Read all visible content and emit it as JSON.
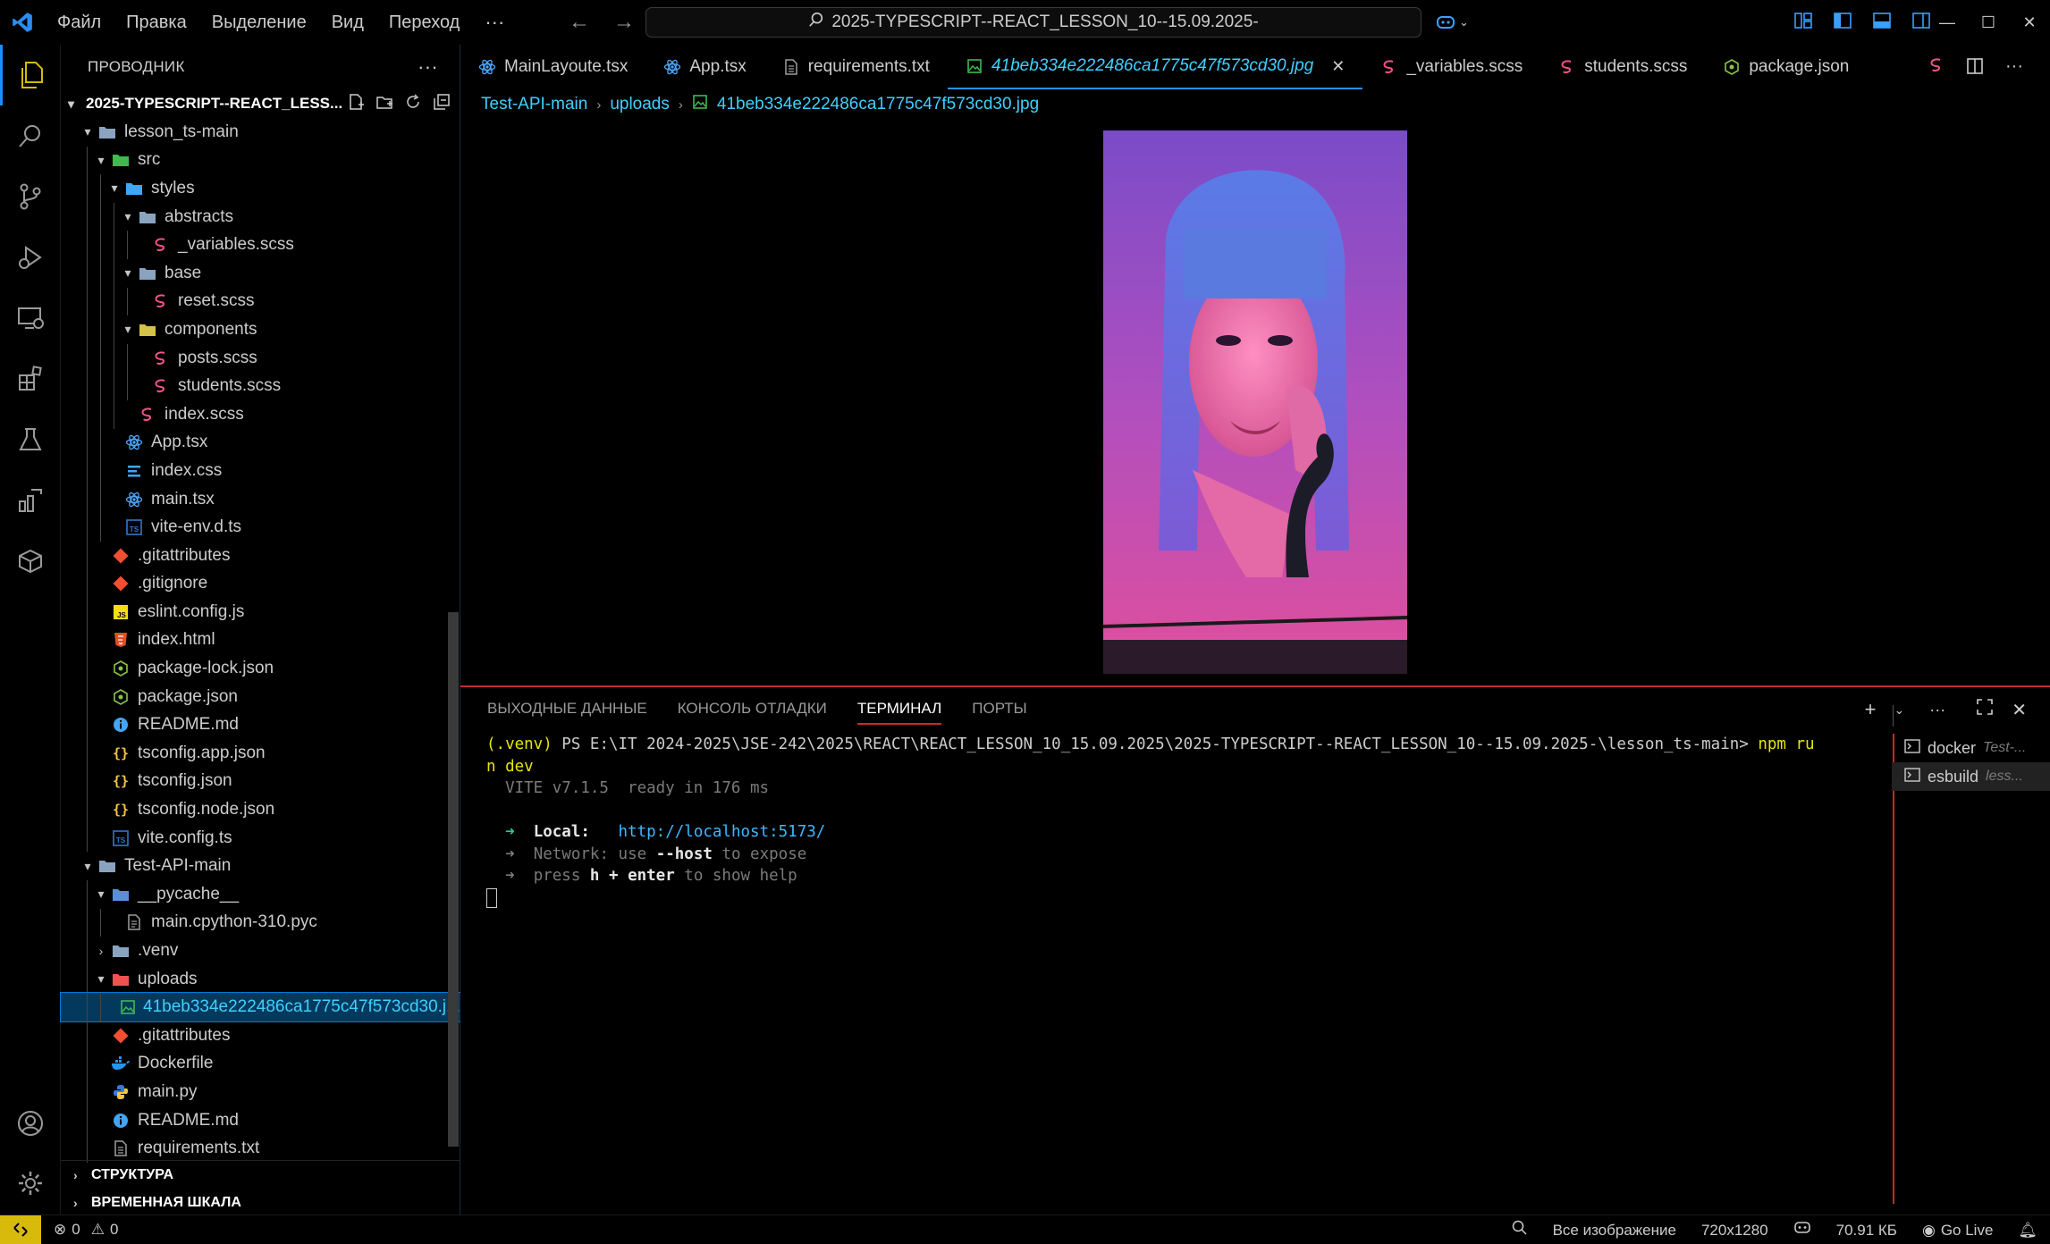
{
  "titlebar": {
    "menu": [
      "Файл",
      "Правка",
      "Выделение",
      "Вид",
      "Переход"
    ],
    "more": "···",
    "search_text": "2025-TYPESCRIPT--REACT_LESSON_10--15.09.2025-"
  },
  "explorer": {
    "header": "ПРОВОДНИК",
    "more": "···",
    "root": "2025-TYPESCRIPT--REACT_LESS...",
    "items": [
      {
        "label": "lesson_ts-main",
        "icon": "folder-open-icon",
        "depth": 1,
        "chevron": "open"
      },
      {
        "label": "src",
        "icon": "folder-src-icon",
        "depth": 2,
        "chevron": "open"
      },
      {
        "label": "styles",
        "icon": "folder-styles-icon",
        "depth": 3,
        "chevron": "open"
      },
      {
        "label": "abstracts",
        "icon": "folder-open-icon",
        "depth": 4,
        "chevron": "open"
      },
      {
        "label": "_variables.scss",
        "icon": "sass-icon",
        "depth": 5
      },
      {
        "label": "base",
        "icon": "folder-open-icon",
        "depth": 4,
        "chevron": "open"
      },
      {
        "label": "reset.scss",
        "icon": "sass-icon",
        "depth": 5
      },
      {
        "label": "components",
        "icon": "folder-components-icon",
        "depth": 4,
        "chevron": "open"
      },
      {
        "label": "posts.scss",
        "icon": "sass-icon",
        "depth": 5
      },
      {
        "label": "students.scss",
        "icon": "sass-icon",
        "depth": 5
      },
      {
        "label": "index.scss",
        "icon": "sass-icon",
        "depth": 4
      },
      {
        "label": "App.tsx",
        "icon": "react-icon",
        "depth": 3
      },
      {
        "label": "index.css",
        "icon": "css-icon",
        "depth": 3
      },
      {
        "label": "main.tsx",
        "icon": "react-icon",
        "depth": 3
      },
      {
        "label": "vite-env.d.ts",
        "icon": "typescript-icon",
        "depth": 3
      },
      {
        "label": ".gitattributes",
        "icon": "git-icon",
        "depth": 2
      },
      {
        "label": ".gitignore",
        "icon": "git-icon",
        "depth": 2
      },
      {
        "label": "eslint.config.js",
        "icon": "javascript-icon",
        "depth": 2
      },
      {
        "label": "index.html",
        "icon": "html-icon",
        "depth": 2
      },
      {
        "label": "package-lock.json",
        "icon": "nodejs-icon",
        "depth": 2
      },
      {
        "label": "package.json",
        "icon": "nodejs-icon",
        "depth": 2
      },
      {
        "label": "README.md",
        "icon": "info-icon",
        "depth": 2
      },
      {
        "label": "tsconfig.app.json",
        "icon": "json-icon",
        "depth": 2
      },
      {
        "label": "tsconfig.json",
        "icon": "json-icon",
        "depth": 2
      },
      {
        "label": "tsconfig.node.json",
        "icon": "json-icon",
        "depth": 2
      },
      {
        "label": "vite.config.ts",
        "icon": "typescript-icon",
        "depth": 2
      },
      {
        "label": "Test-API-main",
        "icon": "folder-open-icon",
        "depth": 1,
        "chevron": "open"
      },
      {
        "label": "__pycache__",
        "icon": "folder-pycache-icon",
        "depth": 2,
        "chevron": "open"
      },
      {
        "label": "main.cpython-310.pyc",
        "icon": "file-binary-icon",
        "depth": 3
      },
      {
        "label": ".venv",
        "icon": "folder-icon",
        "depth": 2,
        "chevron": "closed"
      },
      {
        "label": "uploads",
        "icon": "folder-uploads-icon",
        "depth": 2,
        "chevron": "open"
      },
      {
        "label": "41beb334e222486ca1775c47f573cd30.j...",
        "icon": "image-icon",
        "depth": 3,
        "selected": true
      },
      {
        "label": ".gitattributes",
        "icon": "git-icon",
        "depth": 2
      },
      {
        "label": "Dockerfile",
        "icon": "docker-icon",
        "depth": 2
      },
      {
        "label": "main.py",
        "icon": "python-icon",
        "depth": 2
      },
      {
        "label": "README.md",
        "icon": "info-icon",
        "depth": 2
      },
      {
        "label": "requirements.txt",
        "icon": "text-file-icon",
        "depth": 2
      }
    ],
    "outline": "СТРУКТУРА",
    "timeline": "ВРЕМЕННАЯ ШКАЛА"
  },
  "tabs": [
    {
      "label": "MainLayoute.tsx",
      "icon": "react-icon"
    },
    {
      "label": "App.tsx",
      "icon": "react-icon"
    },
    {
      "label": "requirements.txt",
      "icon": "text-file-icon"
    },
    {
      "label": "41beb334e222486ca1775c47f573cd30.jpg",
      "icon": "image-icon",
      "active": true
    },
    {
      "label": "_variables.scss",
      "icon": "sass-icon"
    },
    {
      "label": "students.scss",
      "icon": "sass-icon"
    },
    {
      "label": "package.json",
      "icon": "nodejs-icon"
    }
  ],
  "breadcrumb": [
    "Test-API-main",
    "uploads",
    "41beb334e222486ca1775c47f573cd30.jpg"
  ],
  "panel": {
    "tabs": [
      "ВЫХОДНЫЕ ДАННЫЕ",
      "КОНСОЛЬ ОТЛАДКИ",
      "ТЕРМИНАЛ",
      "ПОРТЫ"
    ],
    "active_tab": "ТЕРМИНАЛ",
    "terminal": {
      "venv": "(.venv)",
      "prompt": " PS E:\\IT 2024-2025\\JSE-242\\2025\\REACT\\REACT_LESSON_10_15.09.2025\\2025-TYPESCRIPT--REACT_LESSON_10--15.09.2025-\\lesson_ts-main> ",
      "cmd1": "npm ru",
      "cmd2": "n dev",
      "vite_line": "  VITE v7.1.5  ready in 176 ms",
      "local_label": "Local:",
      "local_url": "http://localhost:5173/",
      "network_label": "Network:",
      "network_use": " use ",
      "network_host": "--host",
      "network_tail": " to expose",
      "press": "press ",
      "press_key": "h + enter",
      "press_tail": " to show help"
    },
    "terminals": [
      {
        "name": "docker",
        "detail": "Test-..."
      },
      {
        "name": "esbuild",
        "detail": "less...",
        "active": true
      }
    ]
  },
  "statusbar": {
    "errors": "0",
    "warnings": "0",
    "zoom_label": "Все изображение",
    "dimensions": "720x1280",
    "size": "70.91 КБ",
    "go_live": "Go Live"
  },
  "colors": {
    "accent": "#1c8dff",
    "selection_text": "#3fd0ff",
    "panel_border": "#c42b2b",
    "sass": "#f55385",
    "react": "#4fa8ff",
    "folder": "#8aa4c0",
    "git": "#f14e32",
    "json": "#f5c542",
    "docker": "#2496ed",
    "python": "#3c79d6"
  }
}
